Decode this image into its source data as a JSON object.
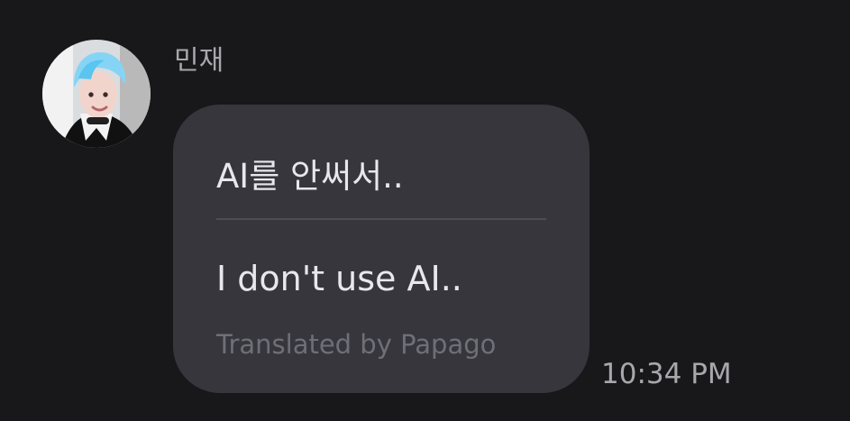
{
  "message": {
    "sender_name": "민재",
    "original_text": "AI를 안써서..",
    "translated_text": "I don't use AI..",
    "translation_credit": "Translated by Papago",
    "timestamp": "10:34 PM"
  },
  "colors": {
    "background": "#18181b",
    "bubble": "#36363c",
    "primary_text": "#e8e8ec",
    "secondary_text": "#a7a7ad",
    "muted_text": "#6f6f79",
    "divider": "#4d4d57"
  },
  "avatar": {
    "icon": "profile-photo"
  }
}
